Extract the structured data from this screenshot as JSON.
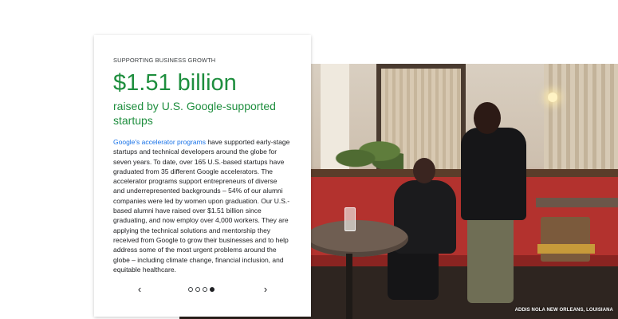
{
  "card": {
    "eyebrow": "SUPPORTING BUSINESS GROWTH",
    "headline": "$1.51 billion",
    "subheadline": "raised by U.S. Google-supported startups",
    "body_link": "Google's accelerator programs",
    "body_text": " have supported early-stage startups and technical developers around the globe for seven years. To date, over 165 U.S.-based startups have graduated from 35 different Google accelerators. The accelerator programs support entrepreneurs of diverse and underrepresented backgrounds – 54% of our alumni companies were led by women upon graduation. Our U.S.-based alumni have raised over $1.51 billion since graduating, and now employ over 4,000 workers. They are applying the technical solutions and mentorship they received from Google to grow their businesses and to help address some of the most urgent problems around the globe – including climate change, financial inclusion, and equitable healthcare."
  },
  "carousel": {
    "prev_icon": "‹",
    "next_icon": "›",
    "total_slides": 4,
    "active_slide": 4
  },
  "photo": {
    "caption": "ADDIS NOLA NEW ORLEANS, LOUISIANA"
  },
  "colors": {
    "headline_green": "#1e8e3e",
    "link_blue": "#1a73e8",
    "text_dark": "#202124"
  }
}
